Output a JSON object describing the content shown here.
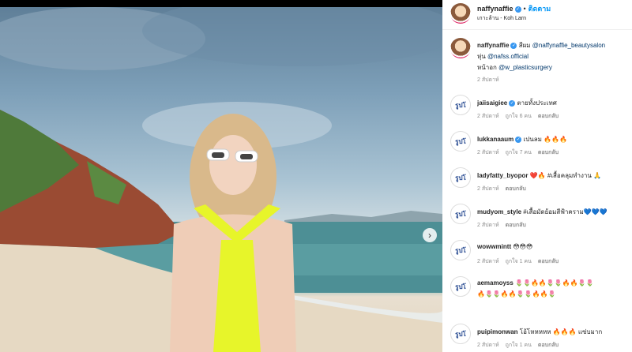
{
  "post": {
    "username": "naffynaffie",
    "follow_label": "ติดตาม",
    "location": "เกาะล้าน - Koh Larn",
    "next_icon": "chevron-right-icon"
  },
  "caption": {
    "username": "naffynaffie",
    "prefix": "สีผม",
    "mention1": "@naffynaffie_beautysalon",
    "line2_prefix": "หุ่น",
    "mention2": "@nafss.official",
    "line3_prefix": "หน้าอก",
    "mention3": "@w_plasticsurgery",
    "time": "2 สัปดาห์"
  },
  "comments": [
    {
      "avatar": "รูปโ",
      "user": "jaiisaigiee",
      "verified": true,
      "text": "ตายทั้งประเทศ",
      "time": "2 สัปดาห์",
      "likes": "ถูกใจ 6 คน",
      "reply": "ตอบกลับ"
    },
    {
      "avatar": "รูปโ",
      "user": "lukkanaaum",
      "verified": true,
      "text": "เปนลม 🔥🔥🔥",
      "time": "2 สัปดาห์",
      "likes": "ถูกใจ 7 คน",
      "reply": "ตอบกลับ"
    },
    {
      "avatar": "รูปโ",
      "user": "ladyfatty_byopor",
      "verified": false,
      "text": "❤️🔥 #เสื้อคลุมทำงาน 🙏",
      "time": "2 สัปดาห์",
      "likes": "",
      "reply": "ตอบกลับ"
    },
    {
      "avatar": "รูปโ",
      "user": "mudyom_style",
      "verified": false,
      "text": "#เสื้อมัดย้อมสีฟ้าคราม💙💙💙",
      "time": "2 สัปดาห์",
      "likes": "",
      "reply": "ตอบกลับ"
    },
    {
      "avatar": "รูปโ",
      "user": "wowwmintt",
      "verified": false,
      "text": "😳😳😳",
      "time": "2 สัปดาห์",
      "likes": "ถูกใจ 1 คน",
      "reply": "ตอบกลับ"
    },
    {
      "avatar": "รูปโ",
      "user": "aemamoyss",
      "verified": false,
      "text": "🌷🌷🔥🔥🌷🌷🔥🔥🌷🌷",
      "line2": "🔥🌷🌷🔥🔥🌷🌷🔥🔥🌷",
      "time": "",
      "likes": "",
      "reply": ""
    },
    {
      "avatar": "รูปโ",
      "user": "puipimonwan",
      "verified": false,
      "text": "โอ้โหหหหห 🔥🔥🔥 แซ่บมาก",
      "time": "2 สัปดาห์",
      "likes": "ถูกใจ 1 คน",
      "reply": "ตอบกลับ"
    }
  ]
}
